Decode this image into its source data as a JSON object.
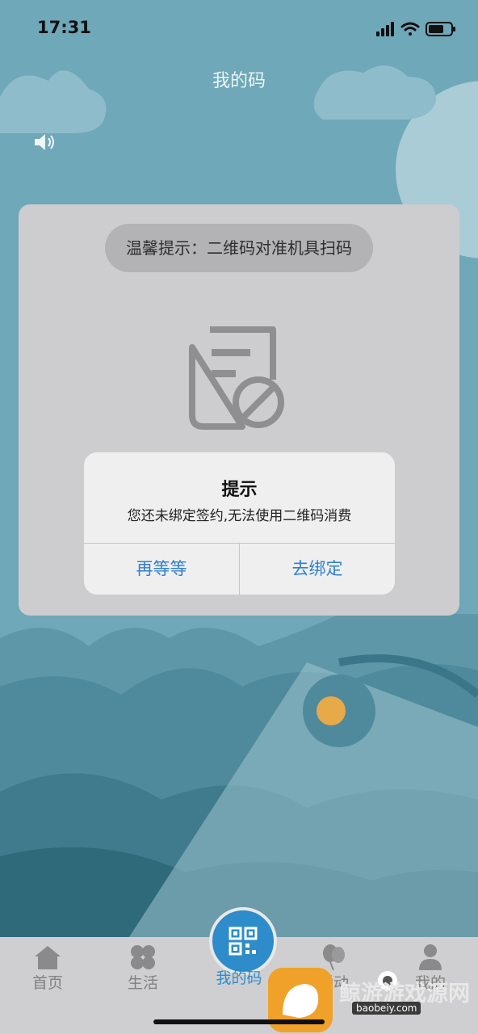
{
  "status_bar": {
    "time": "17:31"
  },
  "header": {
    "title": "我的码"
  },
  "card": {
    "hint": "温馨提示：二维码对准机具扫码"
  },
  "alert": {
    "title": "提示",
    "message": "您还未绑定签约,无法使用二维码消费",
    "cancel_label": "再等等",
    "confirm_label": "去绑定",
    "button_color": "#2f7fd0"
  },
  "tabbar": {
    "tabs": [
      {
        "label": "首页",
        "icon": "home-icon"
      },
      {
        "label": "生活",
        "icon": "clover-icon"
      },
      {
        "label": "我的码",
        "icon": "qr-code-icon",
        "active": true
      },
      {
        "label": "活动",
        "icon": "balloon-icon"
      },
      {
        "label": "我的",
        "icon": "person-icon"
      }
    ]
  },
  "watermark": {
    "text": "鲸游游戏源网",
    "sub": "baobeiy.com"
  },
  "colors": {
    "accent": "#2d8cc9",
    "background": "#6ea9b9",
    "tab_inactive": "#808080"
  }
}
